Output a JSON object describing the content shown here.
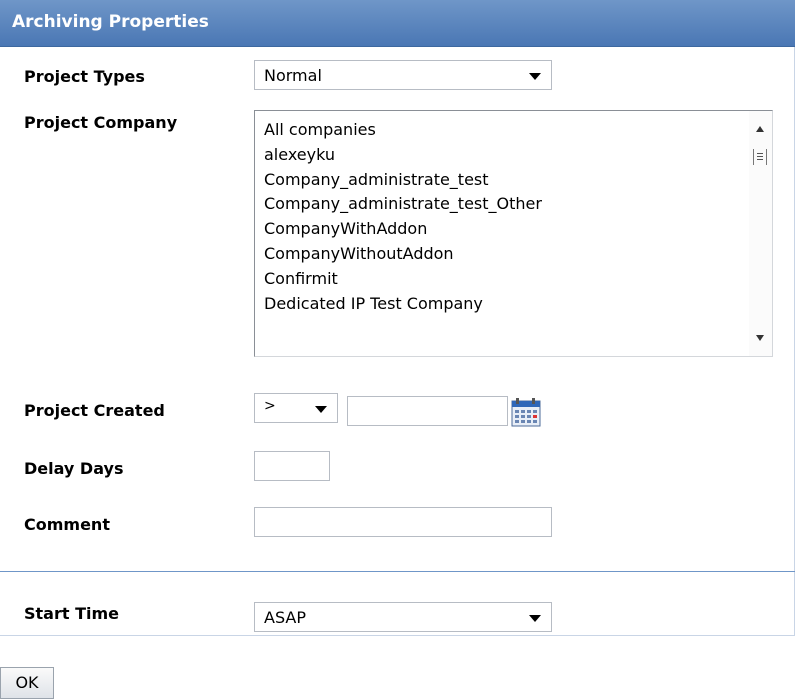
{
  "panel": {
    "title": "Archiving Properties"
  },
  "fields": {
    "project_types": {
      "label": "Project Types",
      "value": "Normal"
    },
    "project_company": {
      "label": "Project Company",
      "options": [
        "All companies",
        "alexeyku",
        "Company_administrate_test",
        "Company_administrate_test_Other",
        "CompanyWithAddon",
        "CompanyWithoutAddon",
        "Confirmit",
        "Dedicated IP Test Company"
      ]
    },
    "project_created": {
      "label": "Project Created",
      "operator": ">",
      "date_value": ""
    },
    "delay_days": {
      "label": "Delay Days",
      "value": ""
    },
    "comment": {
      "label": "Comment",
      "value": ""
    },
    "start_time": {
      "label": "Start Time",
      "value": "ASAP"
    }
  },
  "buttons": {
    "ok_label": "OK"
  },
  "colors": {
    "header": "#4a77b4",
    "divider": "#6f96c8"
  },
  "icons": {
    "calendar": "calendar-icon",
    "dropdown": "chevron-down-icon"
  }
}
